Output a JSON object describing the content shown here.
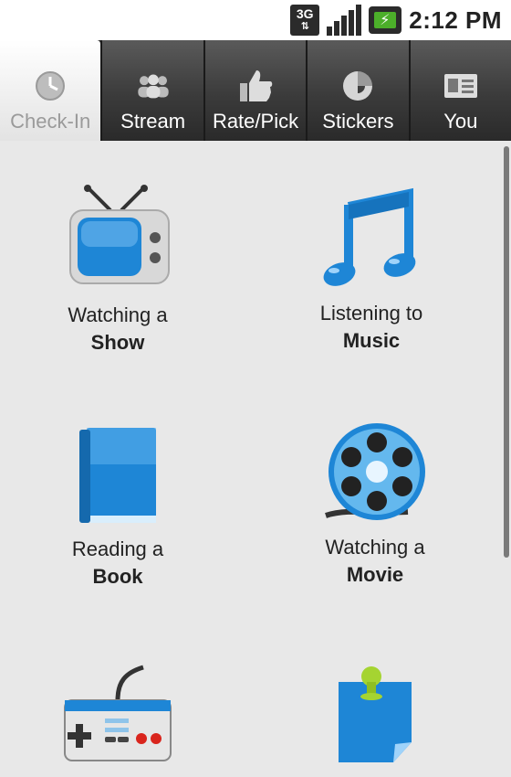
{
  "status_bar": {
    "network": "3G",
    "time": "2:12 PM"
  },
  "tabs": [
    {
      "label": "Check-In",
      "icon": "clock-icon",
      "active": true
    },
    {
      "label": "Stream",
      "icon": "people-icon",
      "active": false
    },
    {
      "label": "Rate/Pick",
      "icon": "thumbs-up-icon",
      "active": false
    },
    {
      "label": "Stickers",
      "icon": "sticker-icon",
      "active": false
    },
    {
      "label": "You",
      "icon": "profile-card-icon",
      "active": false
    }
  ],
  "tiles": [
    {
      "line1": "Watching a",
      "line2": "Show",
      "icon": "tv-icon"
    },
    {
      "line1": "Listening to",
      "line2": "Music",
      "icon": "music-note-icon"
    },
    {
      "line1": "Reading a",
      "line2": "Book",
      "icon": "book-icon"
    },
    {
      "line1": "Watching a",
      "line2": "Movie",
      "icon": "film-reel-icon"
    },
    {
      "line1": "",
      "line2": "",
      "icon": "game-controller-icon"
    },
    {
      "line1": "",
      "line2": "",
      "icon": "sticky-note-icon"
    }
  ],
  "colors": {
    "tab_bar": "#2b2b2b",
    "active_tab": "#e3e3e3",
    "content_bg": "#e8e8e8",
    "accent_blue": "#1e86d6"
  }
}
